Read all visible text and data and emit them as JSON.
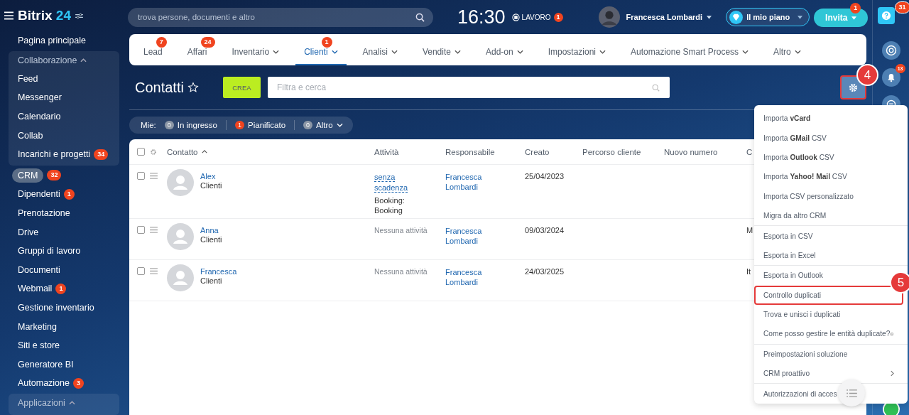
{
  "logo": {
    "name": "Bitrix",
    "number": "24"
  },
  "search": {
    "placeholder": "trova persone, documenti e altro"
  },
  "clock": {
    "time": "16:30",
    "status": "LAVORO",
    "count": "1"
  },
  "user": {
    "name": "Francesca Lombardi"
  },
  "plan_button": {
    "label": "Il mio piano"
  },
  "invite_button": {
    "label": "Invita",
    "count": "1"
  },
  "sidebar": {
    "items": [
      {
        "label": "Pagina principale",
        "kind": "link",
        "selected": false
      },
      {
        "label": "Collaborazione",
        "kind": "group",
        "expanded": true,
        "children": [
          {
            "label": "Feed",
            "selected": false
          },
          {
            "label": "Messenger",
            "selected": false
          },
          {
            "label": "Calendario",
            "selected": false
          },
          {
            "label": "Collab",
            "selected": false
          },
          {
            "label": "Incarichi e progetti",
            "count": "34",
            "selected": false
          }
        ]
      },
      {
        "label": "CRM",
        "kind": "link",
        "selected": true,
        "count": "32"
      },
      {
        "label": "Dipendenti",
        "kind": "link",
        "selected": false,
        "count": "1"
      },
      {
        "label": "Prenotazione",
        "kind": "link",
        "selected": false
      },
      {
        "label": "Drive",
        "kind": "link",
        "selected": false
      },
      {
        "label": "Gruppi di lavoro",
        "kind": "link",
        "selected": false
      },
      {
        "label": "Documenti",
        "kind": "link",
        "selected": false
      },
      {
        "label": "Webmail",
        "kind": "link",
        "selected": false,
        "count": "1"
      },
      {
        "label": "Gestione inventario",
        "kind": "link",
        "selected": false
      },
      {
        "label": "Marketing",
        "kind": "link",
        "selected": false
      },
      {
        "label": "Siti e store",
        "kind": "link",
        "selected": false
      },
      {
        "label": "Generatore BI",
        "kind": "link",
        "selected": false
      },
      {
        "label": "Automazione",
        "kind": "link",
        "selected": false,
        "count": "3"
      },
      {
        "label": "Applicazioni",
        "kind": "group",
        "expanded": true
      }
    ]
  },
  "tabs": [
    {
      "label": "Lead",
      "count": "7",
      "dropdown": false,
      "selected": false
    },
    {
      "label": "Affari",
      "count": "24",
      "dropdown": false,
      "selected": false
    },
    {
      "label": "Inventario",
      "dropdown": true,
      "selected": false
    },
    {
      "label": "Clienti",
      "count": "1",
      "dropdown": true,
      "selected": true
    },
    {
      "label": "Analisi",
      "dropdown": true,
      "selected": false
    },
    {
      "label": "Vendite",
      "dropdown": true,
      "selected": false
    },
    {
      "label": "Add-on",
      "dropdown": true,
      "selected": false
    },
    {
      "label": "Impostazioni",
      "dropdown": true,
      "selected": false
    },
    {
      "label": "Automazione Smart Process",
      "dropdown": true,
      "selected": false
    },
    {
      "label": "Altro",
      "dropdown": true,
      "selected": false
    }
  ],
  "page": {
    "title": "Contatti",
    "create_button": "CREA",
    "filter": {
      "placeholder": "Filtra e cerca"
    },
    "settings_button": {
      "highlighted": true
    }
  },
  "counters": {
    "label": "Mie:",
    "items": [
      {
        "count": "0",
        "label": "In ingresso",
        "alert": false,
        "dropdown": false
      },
      {
        "count": "1",
        "label": "Pianificato",
        "alert": true,
        "dropdown": false
      },
      {
        "count": "0",
        "label": "Altro",
        "alert": false,
        "dropdown": true
      }
    ]
  },
  "table": {
    "all_checked": false,
    "columns": [
      "Contatto",
      "Attività",
      "Responsabile",
      "Creato",
      "Percorso cliente",
      "Nuovo numero",
      "C"
    ],
    "rows": [
      {
        "kind": "deadline",
        "name": "Alex",
        "type": "Clienti",
        "activity": "senza scadenza",
        "activity_note": "Booking: Booking",
        "responsible": "Francesca Lombardi",
        "created": "25/04/2023",
        "checked": false
      },
      {
        "kind": "none",
        "name": "Anna",
        "type": "Clienti",
        "activity": "Nessuna attività",
        "responsible": "Francesca Lombardi",
        "created": "09/03/2024",
        "column_7": "M",
        "checked": false
      },
      {
        "kind": "none",
        "name": "Francesca",
        "type": "Clienti",
        "activity": "Nessuna attività",
        "responsible": "Francesca Lombardi",
        "created": "24/03/2025",
        "column_7": "It",
        "checked": false
      }
    ]
  },
  "settings_menu": {
    "sections": [
      [
        {
          "text": "Importa **vCard**",
          "highlighted": false
        },
        {
          "text": "Importa **GMail** CSV",
          "highlighted": false
        },
        {
          "text": "Importa **Outlook** CSV",
          "highlighted": false
        },
        {
          "text": "Importa **Yahoo! Mail** CSV",
          "highlighted": false
        },
        {
          "text": "Importa CSV personalizzato",
          "highlighted": false
        },
        {
          "text": "Migra da altro CRM",
          "highlighted": false
        }
      ],
      [
        {
          "text": "Esporta in CSV",
          "highlighted": false
        },
        {
          "text": "Esporta in Excel",
          "highlighted": false
        }
      ],
      [
        {
          "text": "Esporta in Outlook",
          "highlighted": false
        },
        {
          "text": "Controllo duplicati",
          "highlighted": true
        },
        {
          "text": "Trova e unisci i duplicati",
          "highlighted": false
        },
        {
          "text": "Come posso gestire le entità duplicate?",
          "highlighted": false,
          "help": true
        }
      ],
      [
        {
          "text": "Preimpostazioni soluzione",
          "highlighted": false
        },
        {
          "text": "CRM proattivo",
          "highlighted": false,
          "submenu": true
        }
      ],
      [
        {
          "text": "Autorizzazioni di acces",
          "highlighted": false
        }
      ]
    ]
  },
  "callouts": [
    {
      "number": "4"
    },
    {
      "number": "5"
    }
  ],
  "right_rail": {
    "help_count": "31",
    "notifications_count": "13"
  }
}
